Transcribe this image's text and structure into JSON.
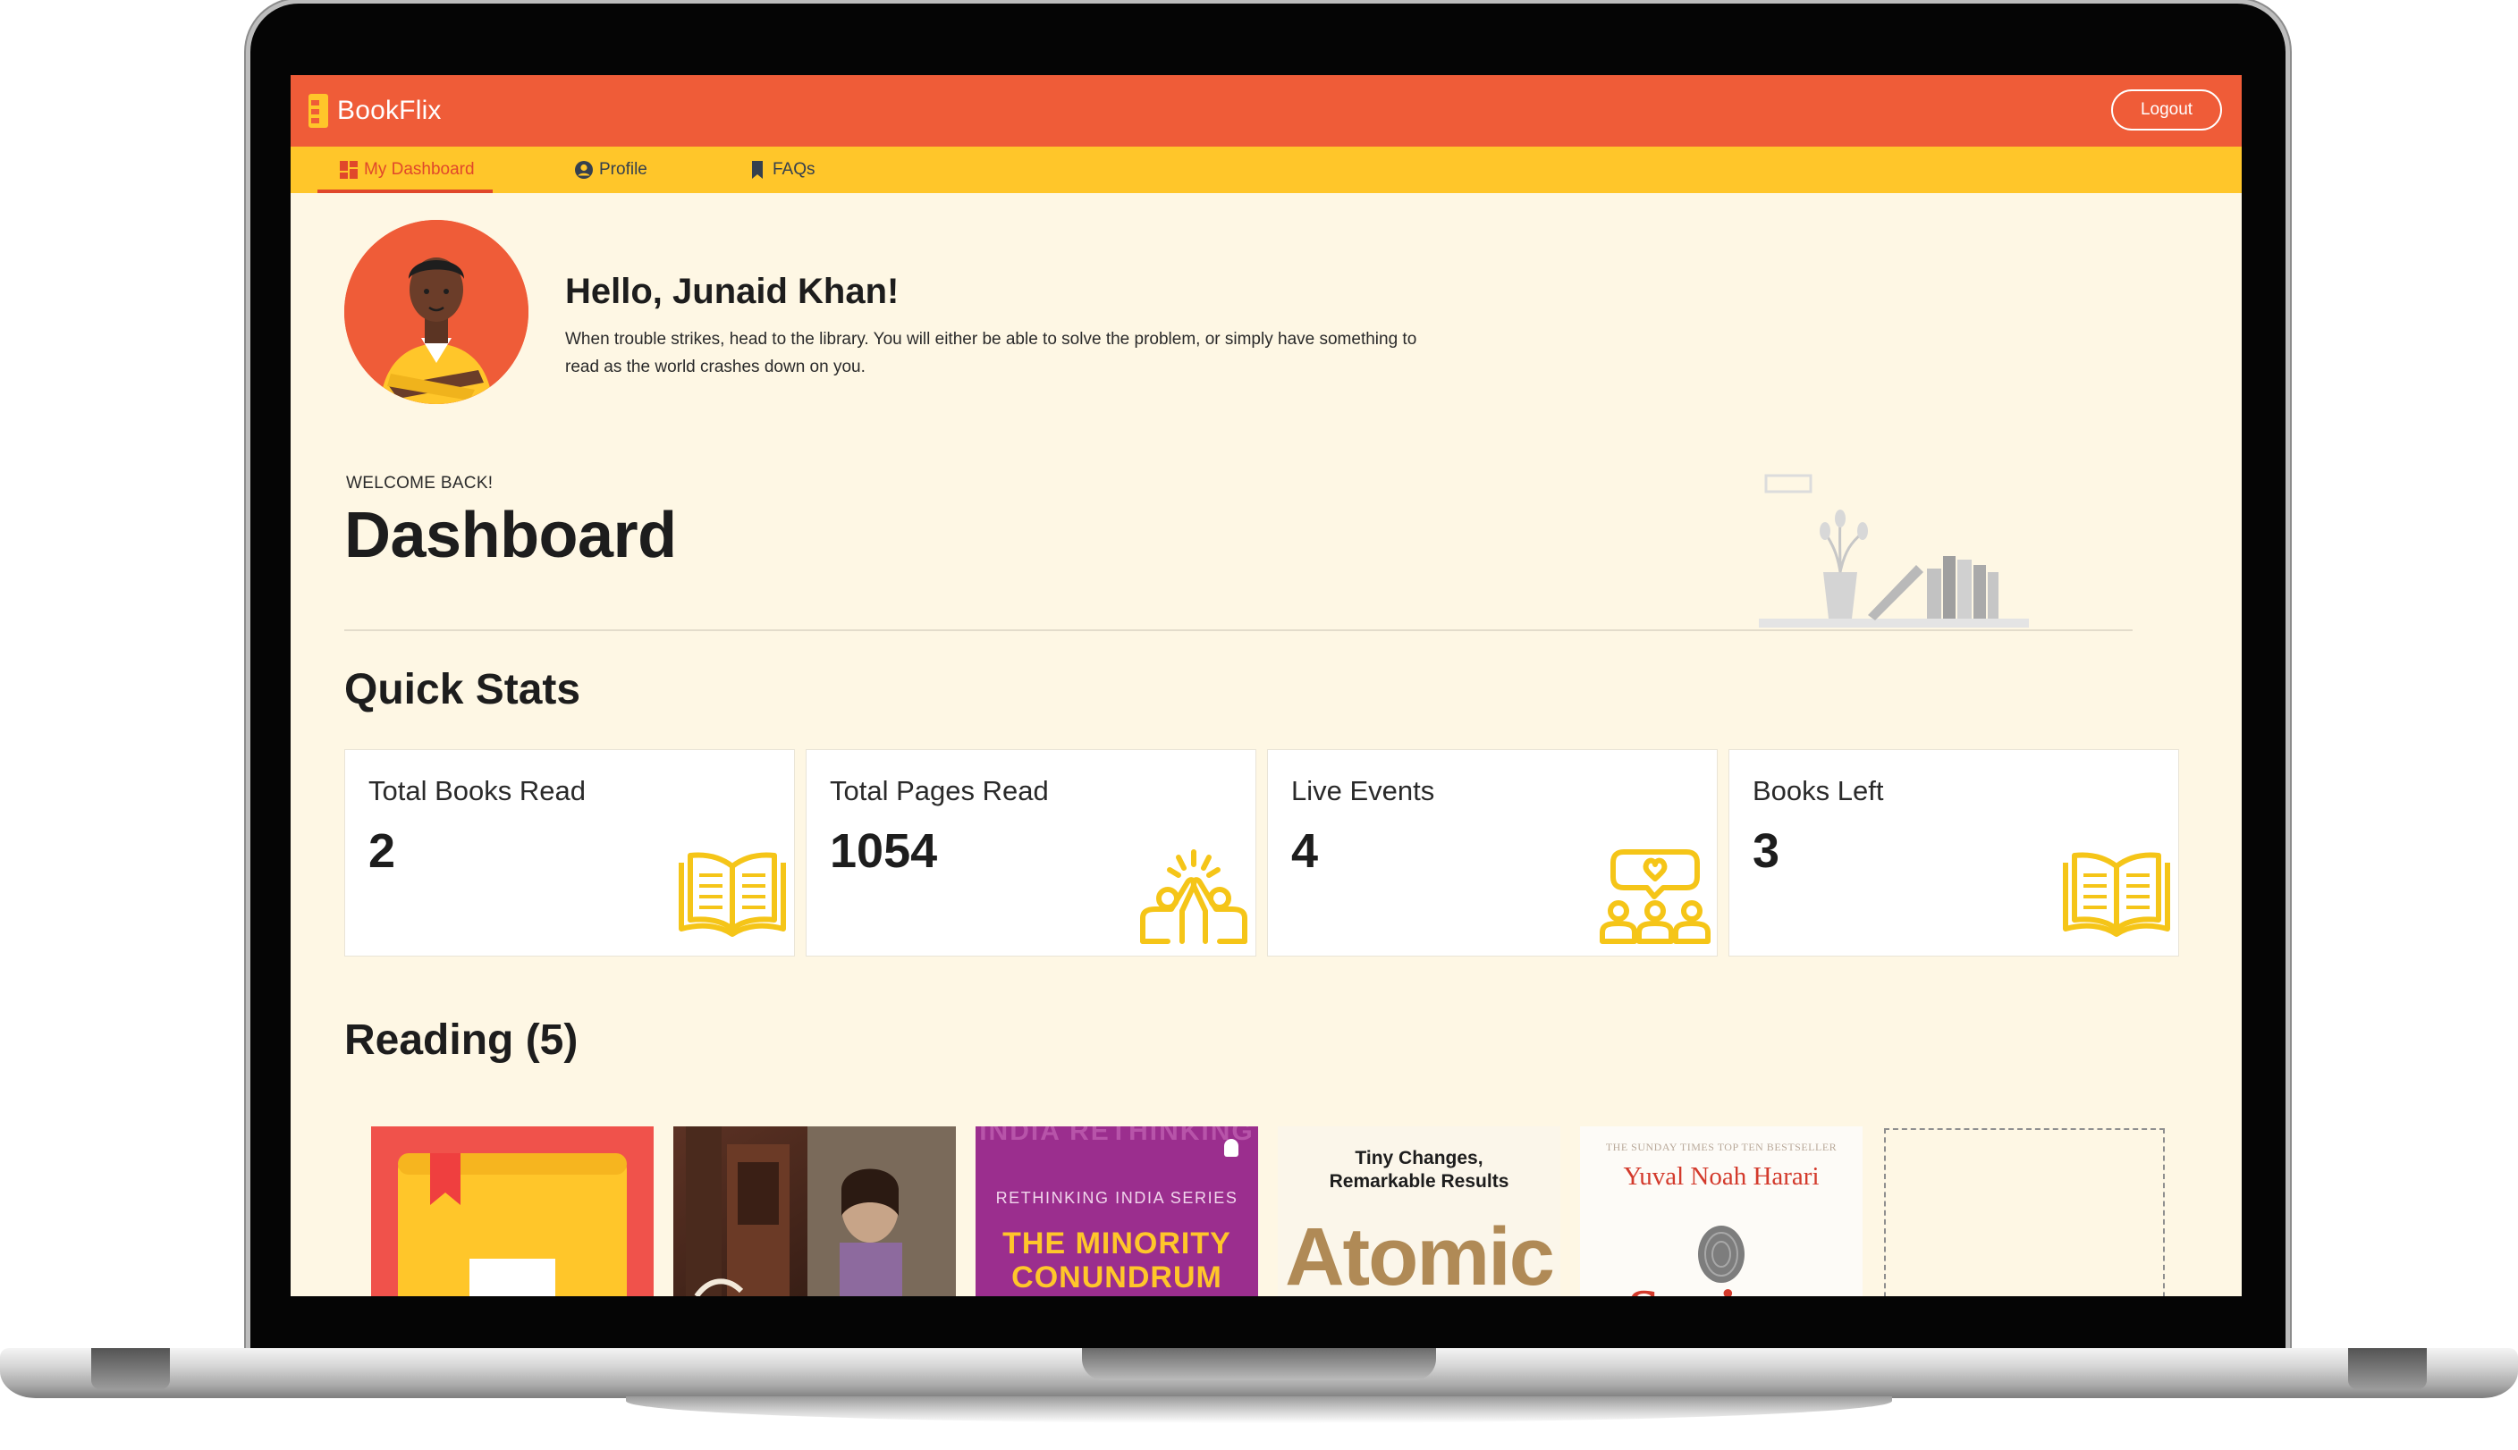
{
  "app": {
    "name": "BookFlix",
    "logout_label": "Logout"
  },
  "nav": {
    "tabs": [
      {
        "label": "My Dashboard",
        "icon": "dashboard-icon",
        "active": true
      },
      {
        "label": "Profile",
        "icon": "user-circle-icon",
        "active": false
      },
      {
        "label": "FAQs",
        "icon": "bookmark-icon",
        "active": false
      }
    ]
  },
  "profile": {
    "greeting": "Hello, Junaid Khan!",
    "quote_line1": "When trouble strikes, head to the library. You will either be able to solve the problem, or simply have something to",
    "quote_line2": "read as the world crashes down on you."
  },
  "dashboard": {
    "eyebrow": "WELCOME BACK!",
    "title": "Dashboard"
  },
  "quick_stats": {
    "title": "Quick Stats",
    "cards": [
      {
        "label": "Total Books Read",
        "value": "2",
        "icon": "open-book-icon"
      },
      {
        "label": "Total Pages Read",
        "value": "1054",
        "icon": "high-five-icon"
      },
      {
        "label": "Live Events",
        "value": "4",
        "icon": "group-chat-icon"
      },
      {
        "label": "Books Left",
        "value": "3",
        "icon": "open-book-icon"
      }
    ]
  },
  "reading": {
    "title": "Reading (5)",
    "books": [
      {
        "cover_text": "",
        "icon": "book-placeholder-icon"
      },
      {
        "cover_text": ""
      },
      {
        "series": "RETHINKING INDIA SERIES",
        "title_line1": "THE MINORITY",
        "title_line2": "CONUNDRUM",
        "bg_text": "INDIA RETHINKING"
      },
      {
        "tagline_line1": "Tiny Changes,",
        "tagline_line2": "Remarkable Results",
        "title": "Atomic"
      },
      {
        "banner": "THE SUNDAY TIMES TOP TEN BESTSELLER",
        "author": "Yuval Noah Harari",
        "title": "Sapiens"
      }
    ]
  },
  "colors": {
    "primary": "#ef5c38",
    "secondary": "#ffc62a",
    "background": "#fef7e4",
    "icon_yellow": "#f5c518"
  }
}
